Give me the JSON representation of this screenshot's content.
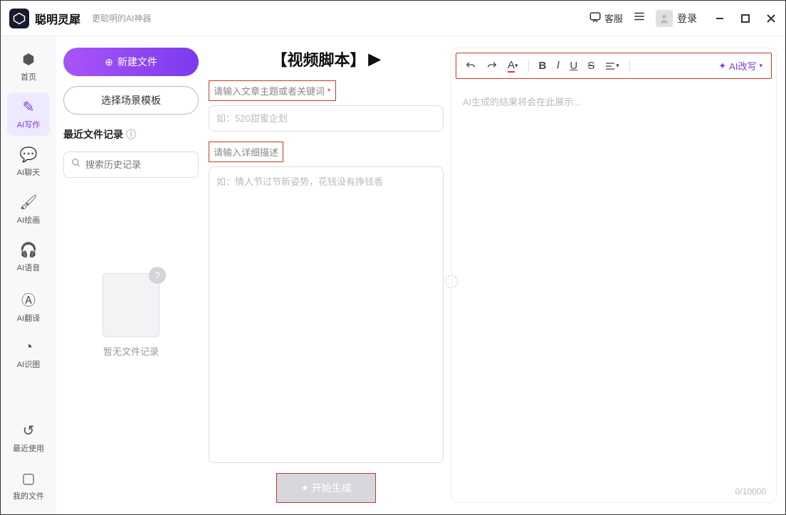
{
  "titlebar": {
    "app_name": "聪明灵犀",
    "app_sub": "更聪明的AI神器",
    "support": "客服",
    "login": "登录"
  },
  "sidebar": {
    "items": [
      {
        "label": "首页",
        "icon": "⬢"
      },
      {
        "label": "AI写作",
        "icon": "✎"
      },
      {
        "label": "AI聊天",
        "icon": "💬"
      },
      {
        "label": "AI绘画",
        "icon": "🖌"
      },
      {
        "label": "AI语音",
        "icon": "🎧"
      },
      {
        "label": "AI翻译",
        "icon": "Ⓐ"
      },
      {
        "label": "AI识图",
        "icon": "◔"
      }
    ],
    "recent_label": "最近使用",
    "myfiles_label": "我的文件"
  },
  "files": {
    "new_file": "新建文件",
    "template": "选择场景模板",
    "recent_header": "最近文件记录",
    "search_placeholder": "搜索历史记录",
    "empty": "暂无文件记录"
  },
  "editor": {
    "title": "【视频脚本】",
    "topic_label": "请输入文章主题或者关键词",
    "topic_placeholder": "如：520甜蜜企划",
    "desc_label": "请输入详细描述",
    "desc_placeholder": "如：情人节过节新姿势，花钱没有挣钱香",
    "generate": "✦ 开始生成"
  },
  "output": {
    "placeholder": "AI生成的结果将会在此展示...",
    "ai_rewrite": "AI改写",
    "counter": "0/10000",
    "font_label": "A"
  }
}
